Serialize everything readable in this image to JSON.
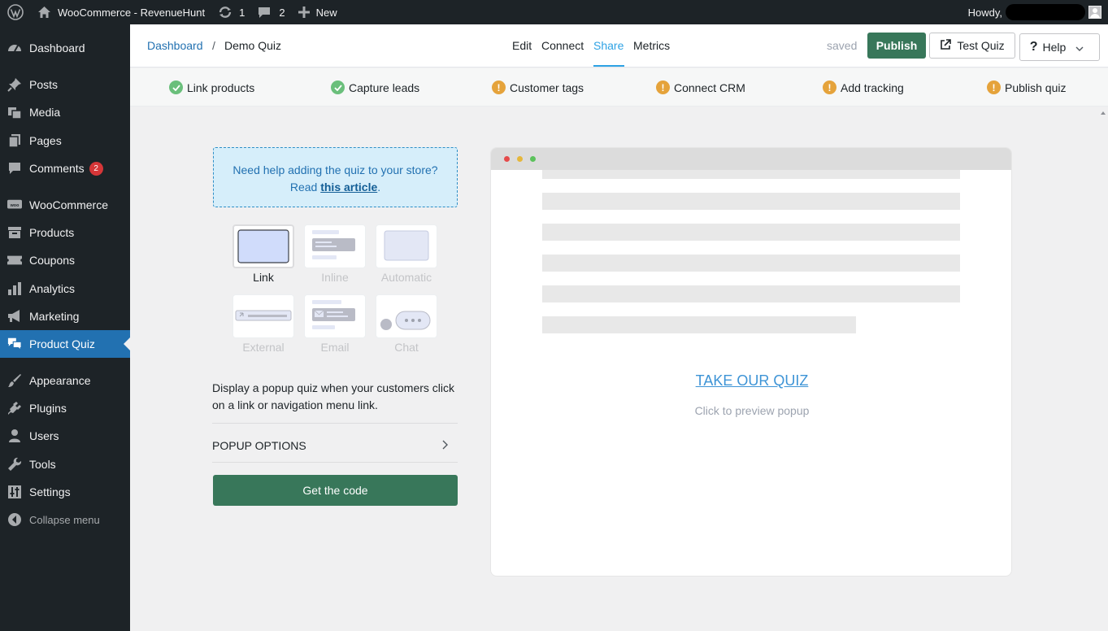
{
  "adminbar": {
    "site_name": "WooCommerce - RevenueHunt",
    "updates_count": "1",
    "comments_count": "2",
    "new_label": "New",
    "howdy": "Howdy,"
  },
  "sidebar": {
    "items": [
      {
        "label": "Dashboard",
        "icon": "dashboard-icon"
      },
      {
        "label": "Posts",
        "icon": "pin-icon"
      },
      {
        "label": "Media",
        "icon": "media-icon"
      },
      {
        "label": "Pages",
        "icon": "pages-icon"
      },
      {
        "label": "Comments",
        "icon": "comment-icon",
        "badge": "2"
      },
      {
        "label": "WooCommerce",
        "icon": "woo-icon"
      },
      {
        "label": "Products",
        "icon": "archive-icon"
      },
      {
        "label": "Coupons",
        "icon": "ticket-icon"
      },
      {
        "label": "Analytics",
        "icon": "bar-chart-icon"
      },
      {
        "label": "Marketing",
        "icon": "megaphone-icon"
      },
      {
        "label": "Product Quiz",
        "icon": "chat-bubbles-icon",
        "active": true
      },
      {
        "label": "Appearance",
        "icon": "paintbrush-icon"
      },
      {
        "label": "Plugins",
        "icon": "plug-icon"
      },
      {
        "label": "Users",
        "icon": "user-icon"
      },
      {
        "label": "Tools",
        "icon": "wrench-icon"
      },
      {
        "label": "Settings",
        "icon": "sliders-icon"
      }
    ],
    "collapse_label": "Collapse menu"
  },
  "header": {
    "breadcrumb_root": "Dashboard",
    "breadcrumb_sep": "/",
    "breadcrumb_current": "Demo Quiz",
    "tabs": [
      "Edit",
      "Connect",
      "Share",
      "Metrics"
    ],
    "active_tab": "Share",
    "status": "saved",
    "publish_label": "Publish",
    "test_label": "Test Quiz",
    "help_label": "Help"
  },
  "checklist": [
    {
      "label": "Link products",
      "state": "done"
    },
    {
      "label": "Capture leads",
      "state": "done"
    },
    {
      "label": "Customer tags",
      "state": "warn"
    },
    {
      "label": "Connect CRM",
      "state": "warn"
    },
    {
      "label": "Add tracking",
      "state": "warn"
    },
    {
      "label": "Publish quiz",
      "state": "warn"
    }
  ],
  "share": {
    "help_line1": "Need help adding the quiz to your store?",
    "help_read": "Read ",
    "help_link": "this article",
    "help_end": ".",
    "options": [
      {
        "label": "Link",
        "selected": true
      },
      {
        "label": "Inline"
      },
      {
        "label": "Automatic"
      },
      {
        "label": "External"
      },
      {
        "label": "Email"
      },
      {
        "label": "Chat"
      }
    ],
    "description": "Display a popup quiz when your customers click on a link or navigation menu link.",
    "popup_options_label": "POPUP OPTIONS",
    "get_code_label": "Get the code"
  },
  "preview": {
    "cta": "TAKE OUR QUIZ",
    "hint": "Click to preview popup"
  },
  "colors": {
    "admin_dark": "#1d2327",
    "wp_blue": "#2271b1",
    "green": "#38775a",
    "tab_active": "#2ea2e4",
    "warn": "#e5a33b",
    "done": "#6abf7b"
  }
}
